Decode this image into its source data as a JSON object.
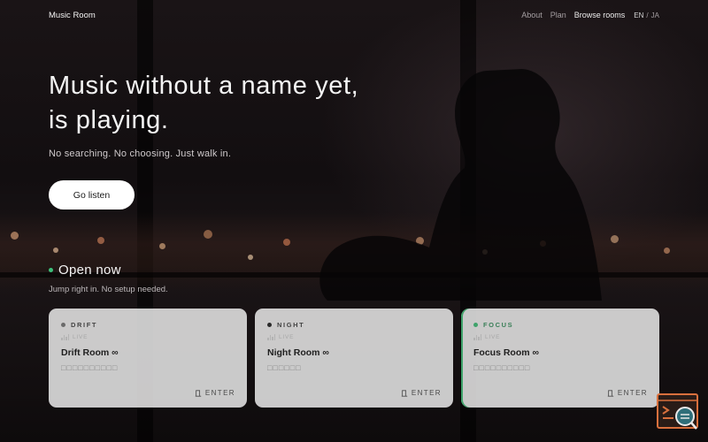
{
  "nav": {
    "brand": "Music Room",
    "links": [
      "About",
      "Plan",
      "Browse rooms"
    ],
    "lang_en": "EN",
    "lang_sep": "/",
    "lang_ja": "JA"
  },
  "hero": {
    "title_line1": "Music without a name yet,",
    "title_line2": "is playing.",
    "subtitle": "No searching. No choosing. Just walk in.",
    "cta": "Go listen"
  },
  "open_now": {
    "title": "Open now",
    "subtitle": "Jump right in. No setup needed."
  },
  "cards": [
    {
      "tag": "DRIFT",
      "live": "LIVE",
      "name": "Drift Room ∞",
      "blurb": "□□□□□□□□□□",
      "enter": "ENTER",
      "dot_color": "#6b6b6b"
    },
    {
      "tag": "NIGHT",
      "live": "LIVE",
      "name": "Night Room ∞",
      "blurb": "□□□□□□",
      "enter": "ENTER",
      "dot_color": "#2a2a2a"
    },
    {
      "tag": "FOCUS",
      "live": "LIVE",
      "name": "Focus Room ∞",
      "blurb": "□□□□□□□□□□",
      "enter": "ENTER",
      "dot_color": "#3fa36b"
    }
  ],
  "colors": {
    "accent_green": "#3cc07a",
    "widget_orange": "#d9703d",
    "widget_teal": "#2f6e79"
  },
  "icons": {
    "live": "equalizer-icon",
    "enter": "door-icon",
    "widget": "terminal-search-icon"
  }
}
